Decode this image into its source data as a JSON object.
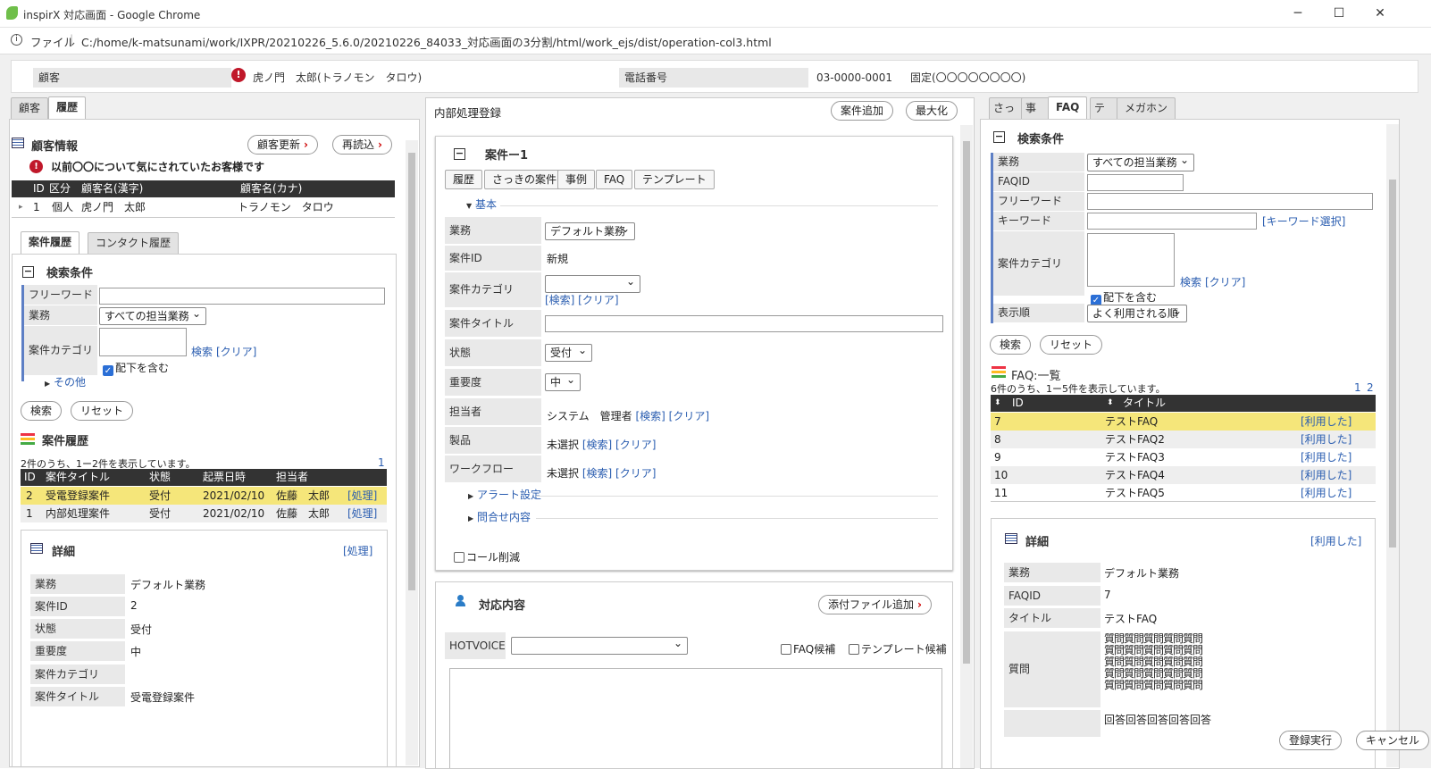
{
  "window": {
    "title": "inspirX 対応画面 - Google Chrome"
  },
  "addressbar": {
    "scheme": "ファイル",
    "url": "C:/home/k-matsunami/work/IXPR/20210226_5.6.0/20210226_84033_対応画面の3分割/html/work_ejs/dist/operation-col3.html"
  },
  "header": {
    "customer_label": "顧客",
    "customer_name": "虎ノ門　太郎(トラノモン　タロウ)",
    "phone_label": "電話番号",
    "phone": "03-0000-0001",
    "phone_type": "固定(〇〇〇〇〇〇〇〇)"
  },
  "left": {
    "tabs": [
      "顧客",
      "履歴"
    ],
    "customer_info_title": "顧客情報",
    "btn_update": "顧客更新",
    "btn_reload": "再読込",
    "warning": "以前〇〇について気にされていたお客様です",
    "cust_table": {
      "headers": [
        "ID",
        "区分",
        "顧客名(漢字)",
        "顧客名(カナ)"
      ],
      "row": [
        "1",
        "個人",
        "虎ノ門　太郎",
        "トラノモン　タロウ"
      ]
    },
    "history_tabs": [
      "案件履歴",
      "コンタクト履歴"
    ],
    "search_title": "検索条件",
    "f_freeword": "フリーワード",
    "f_business": "業務",
    "f_business_value": "すべての担当業務",
    "f_category": "案件カテゴリ",
    "search_link": "検索",
    "clear_link": "[クリア]",
    "include_sub": "配下を含む",
    "other": "その他",
    "btn_search": "検索",
    "btn_reset": "リセット",
    "history_title": "案件履歴",
    "count_text": "2件のうち、1ー2件を表示しています。",
    "page": "1",
    "hist_headers": [
      "ID",
      "案件タイトル",
      "状態",
      "起票日時",
      "担当者"
    ],
    "hist_rows": [
      {
        "id": "2",
        "title": "受電登録案件",
        "status": "受付",
        "date": "2021/02/10",
        "user": "佐藤　太郎",
        "action": "[処理]"
      },
      {
        "id": "1",
        "title": "内部処理案件",
        "status": "受付",
        "date": "2021/02/10",
        "user": "佐藤　太郎",
        "action": "[処理]"
      }
    ],
    "detail_title": "詳細",
    "detail_action": "[処理]",
    "detail": [
      {
        "label": "業務",
        "value": "デフォルト業務"
      },
      {
        "label": "案件ID",
        "value": "2"
      },
      {
        "label": "状態",
        "value": "受付"
      },
      {
        "label": "重要度",
        "value": "中"
      },
      {
        "label": "案件カテゴリ",
        "value": ""
      },
      {
        "label": "案件タイトル",
        "value": "受電登録案件"
      }
    ]
  },
  "center": {
    "title": "内部処理登録",
    "btn_add": "案件追加",
    "btn_max": "最大化",
    "case_title": "案件ー1",
    "case_tabs": [
      "履歴",
      "さっきの案件",
      "事例",
      "FAQ",
      "テンプレート"
    ],
    "basic": "基本",
    "fields": {
      "business": "業務",
      "business_value": "デフォルト業務",
      "case_id": "案件ID",
      "case_id_value": "新規",
      "category": "案件カテゴリ",
      "category_links": "[検索] [クリア]",
      "case_title": "案件タイトル",
      "status": "状態",
      "status_value": "受付",
      "priority": "重要度",
      "priority_value": "中",
      "assignee": "担当者",
      "assignee_value": "システム　管理者",
      "assignee_links": "[検索] [クリア]",
      "product": "製品",
      "product_value": "未選択",
      "product_links": "[検索] [クリア]",
      "workflow": "ワークフロー",
      "workflow_value": "未選択",
      "workflow_links": "[検索] [クリア]"
    },
    "alert": "アラート設定",
    "inquiry": "問合せ内容",
    "call_reduce": "コール削減",
    "response_title": "対応内容",
    "btn_attach": "添付ファイル追加",
    "hotvoice": "HOTVOICE",
    "faq_candidate": "FAQ候補",
    "template_candidate": "テンプレート候補"
  },
  "right": {
    "tabs": [
      "さっき",
      "事例",
      "FAQ",
      "テンプ",
      "メガホン"
    ],
    "search_title": "検索条件",
    "f_business": "業務",
    "f_business_value": "すべての担当業務",
    "f_faqid": "FAQID",
    "f_freeword": "フリーワード",
    "f_keyword": "キーワード",
    "keyword_link": "[キーワード選択]",
    "f_category": "案件カテゴリ",
    "search_link": "検索",
    "clear_link": "[クリア]",
    "include_sub": "配下を含む",
    "f_order": "表示順",
    "f_order_value": "よく利用される順",
    "btn_search": "検索",
    "btn_reset": "リセット",
    "list_title": "FAQ:一覧",
    "count_text": "6件のうち、1ー5件を表示しています。",
    "pages": [
      "1",
      "2"
    ],
    "list_headers": [
      "ID",
      "タイトル"
    ],
    "rows": [
      {
        "id": "7",
        "title": "テストFAQ",
        "action": "[利用した]"
      },
      {
        "id": "8",
        "title": "テストFAQ2",
        "action": "[利用した]"
      },
      {
        "id": "9",
        "title": "テストFAQ3",
        "action": "[利用した]"
      },
      {
        "id": "10",
        "title": "テストFAQ4",
        "action": "[利用した]"
      },
      {
        "id": "11",
        "title": "テストFAQ5",
        "action": "[利用した]"
      }
    ],
    "detail_title": "詳細",
    "detail_action": "[利用した]",
    "detail": [
      {
        "label": "業務",
        "value": "デフォルト業務"
      },
      {
        "label": "FAQID",
        "value": "7"
      },
      {
        "label": "タイトル",
        "value": "テストFAQ"
      }
    ],
    "question_label": "質問",
    "question_lines": [
      "質問質問質問質問質問",
      "質問質問質問質問質問",
      "質問質問質問質問質問",
      "質問質問質問質問質問",
      "質問質問質問質問質問"
    ],
    "answer_value": "回答回答回答回答回答"
  },
  "footer": {
    "btn_register": "登録実行",
    "btn_cancel": "キャンセル"
  }
}
